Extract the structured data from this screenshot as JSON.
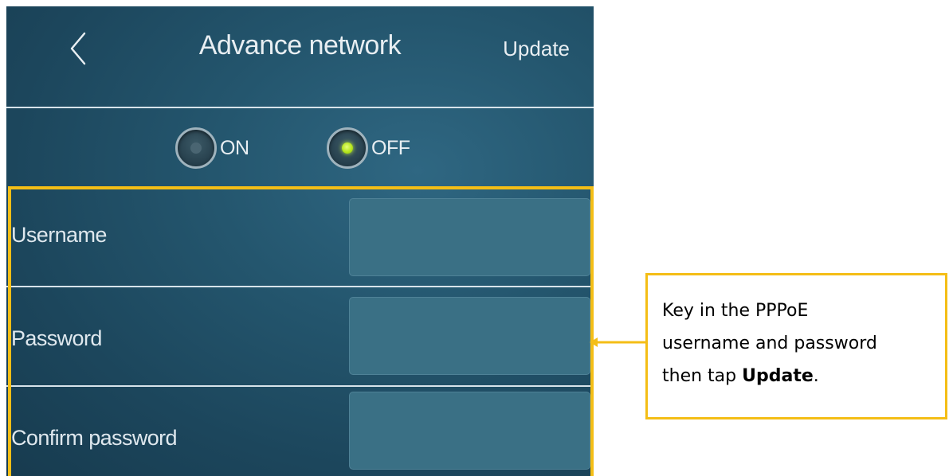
{
  "header": {
    "back_icon": "chevron-left-icon",
    "title": "Advance network",
    "update_label": "Update"
  },
  "pppoe_toggle": {
    "on_label": "ON",
    "off_label": "OFF",
    "selected": "OFF"
  },
  "form": {
    "fields": [
      {
        "label": "Username",
        "value": ""
      },
      {
        "label": "Password",
        "value": ""
      },
      {
        "label": "Confirm password",
        "value": ""
      }
    ]
  },
  "callout": {
    "line1": "Key in the PPPoE",
    "line2": "username and password",
    "line3_prefix": "then tap ",
    "line3_bold": "Update",
    "line3_suffix": "."
  },
  "colors": {
    "highlight": "#f4be16",
    "active_radio": "#b5e51d",
    "background": "#24566e",
    "input_fill": "#3a7085"
  }
}
